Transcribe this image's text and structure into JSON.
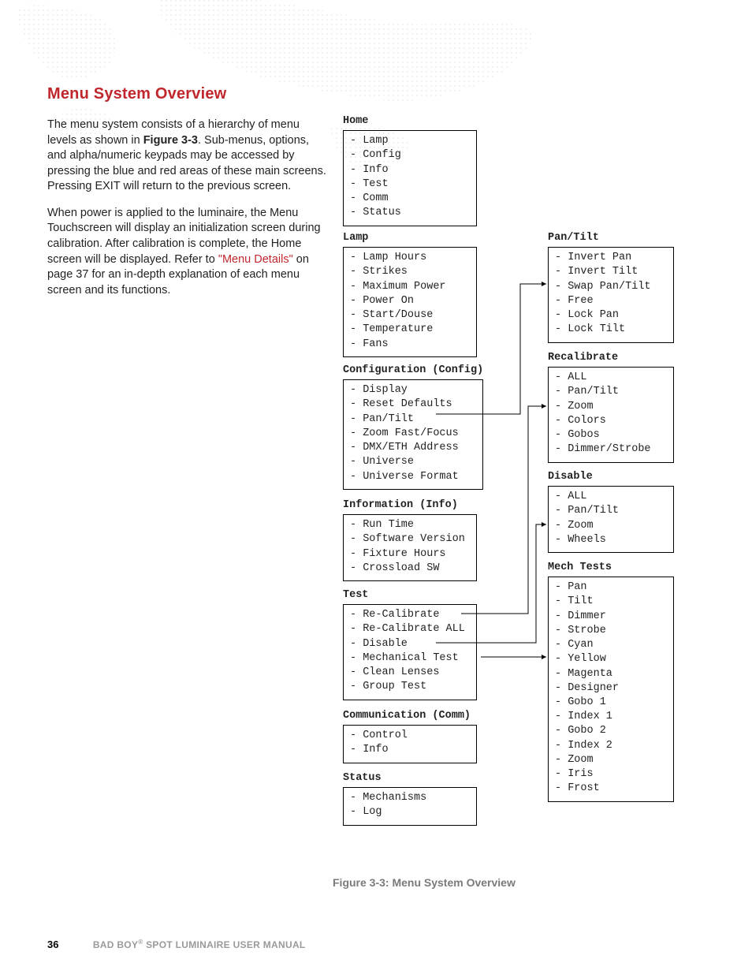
{
  "title": "Menu System Overview",
  "para1_a": "The menu system consists of a hierarchy of menu levels as shown in ",
  "para1_figref": "Figure 3-3",
  "para1_b": ". Sub-menus, options, and alpha/numeric keypads may be accessed by pressing the blue and red areas of these main screens. Pressing EXIT will return to the previous screen.",
  "para2_a": "When power is applied to the luminaire, the Menu Touchscreen will display an initialization screen during calibration. After calibration is complete, the Home screen will be displayed. Refer to ",
  "para2_link": "\"Menu Details\"",
  "para2_b": " on page 37 for an in-depth explanation of each menu screen and its functions.",
  "caption": "Figure 3-3:  Menu System Overview",
  "footer_pagenum": "36",
  "footer_text_a": "BAD BOY",
  "footer_text_b": " SPOT LUMINAIRE USER MANUAL",
  "menus": {
    "home": {
      "title": "Home",
      "items": [
        "Lamp",
        "Config",
        "Info",
        "Test",
        "Comm",
        "Status"
      ]
    },
    "lamp": {
      "title": "Lamp",
      "items": [
        "Lamp Hours",
        "Strikes",
        "Maximum Power",
        "Power On",
        "Start/Douse",
        "Temperature",
        "Fans"
      ]
    },
    "config": {
      "title": "Configuration (Config)",
      "items": [
        "Display",
        "Reset Defaults",
        "Pan/Tilt",
        "Zoom Fast/Focus",
        "DMX/ETH Address",
        "Universe",
        "Universe Format"
      ]
    },
    "info": {
      "title": "Information (Info)",
      "items": [
        "Run Time",
        "Software Version",
        "Fixture Hours",
        "Crossload SW"
      ]
    },
    "test": {
      "title": "Test",
      "items": [
        "Re-Calibrate",
        "Re-Calibrate ALL",
        "Disable",
        "Mechanical Test",
        "Clean Lenses",
        "Group Test"
      ]
    },
    "comm": {
      "title": "Communication (Comm)",
      "items": [
        "Control",
        "Info"
      ]
    },
    "status": {
      "title": "Status",
      "items": [
        "Mechanisms",
        "Log"
      ]
    },
    "pantilt": {
      "title": "Pan/Tilt",
      "items": [
        "Invert Pan",
        "Invert Tilt",
        "Swap Pan/Tilt",
        "Free",
        "Lock Pan",
        "Lock Tilt"
      ]
    },
    "recal": {
      "title": "Recalibrate",
      "items": [
        "ALL",
        "Pan/Tilt",
        "Zoom",
        "Colors",
        "Gobos",
        "Dimmer/Strobe"
      ]
    },
    "disable": {
      "title": "Disable",
      "items": [
        "ALL",
        "Pan/Tilt",
        "Zoom",
        "Wheels"
      ]
    },
    "mech": {
      "title": "Mech Tests",
      "items": [
        "Pan",
        "Tilt",
        "Dimmer",
        "Strobe",
        "Cyan",
        "Yellow",
        "Magenta",
        "Designer",
        "Gobo 1",
        "Index 1",
        "Gobo 2",
        "Index 2",
        "Zoom",
        "Iris",
        "Frost"
      ]
    }
  }
}
